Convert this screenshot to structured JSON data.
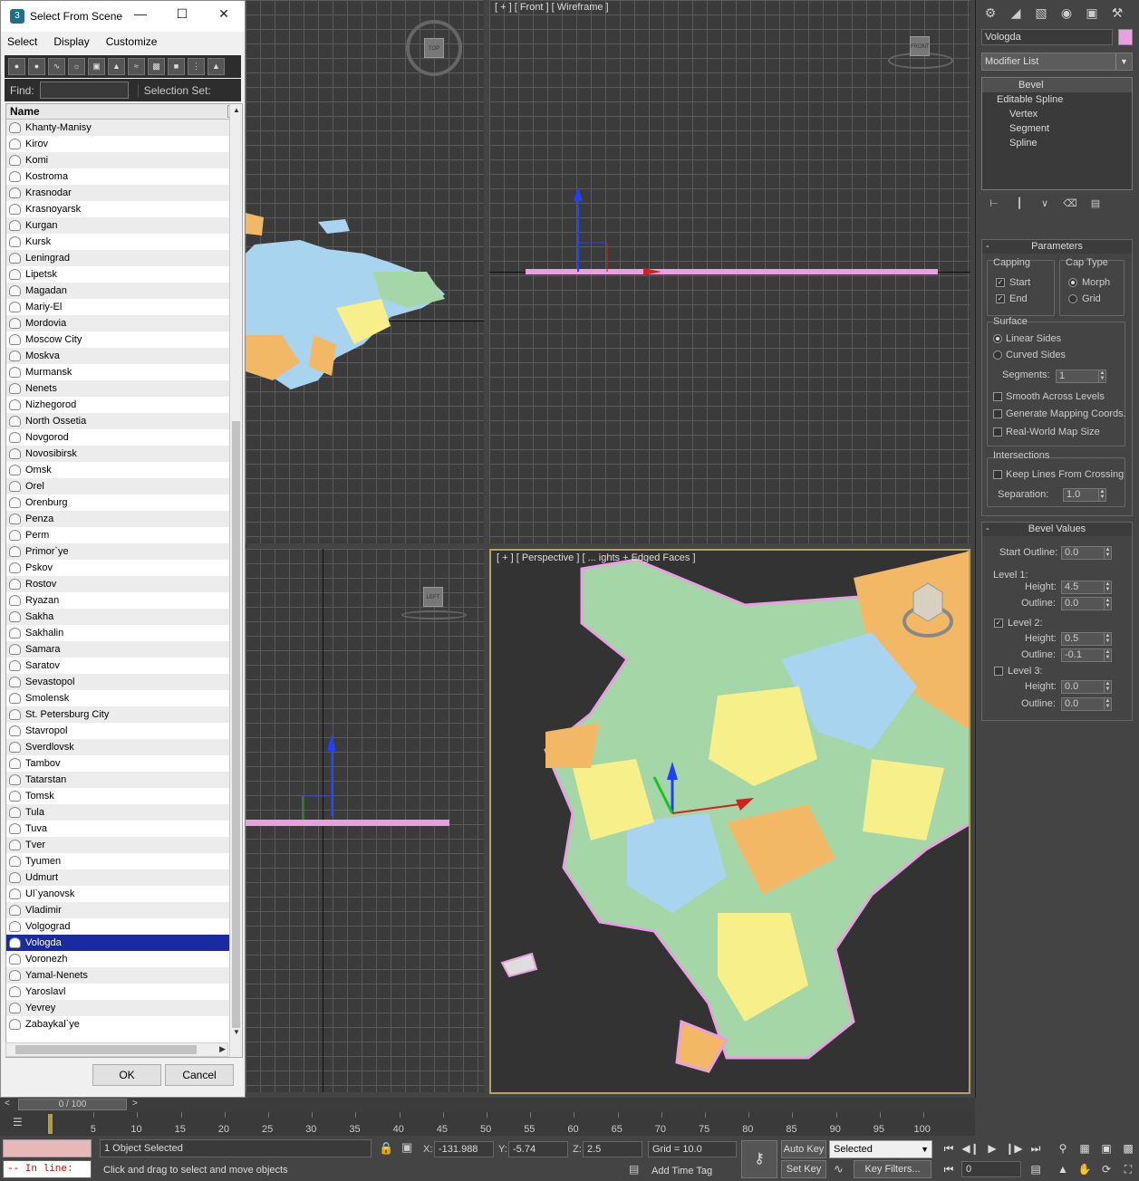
{
  "dialog": {
    "title": "Select From Scene",
    "menu": [
      "Select",
      "Display",
      "Customize"
    ],
    "find_label": "Find:",
    "find_value": "",
    "selection_set_label": "Selection Set:",
    "column_header": "Name",
    "items": [
      "Khanty-Manisy",
      "Kirov",
      "Komi",
      "Kostroma",
      "Krasnodar",
      "Krasnoyarsk",
      "Kurgan",
      "Kursk",
      "Leningrad",
      "Lipetsk",
      "Magadan",
      "Mariy-El",
      "Mordovia",
      "Moscow City",
      "Moskva",
      "Murmansk",
      "Nenets",
      "Nizhegorod",
      "North Ossetia",
      "Novgorod",
      "Novosibirsk",
      "Omsk",
      "Orel",
      "Orenburg",
      "Penza",
      "Perm",
      "Primor`ye",
      "Pskov",
      "Rostov",
      "Ryazan",
      "Sakha",
      "Sakhalin",
      "Samara",
      "Saratov",
      "Sevastopol",
      "Smolensk",
      "St. Petersburg City",
      "Stavropol",
      "Sverdlovsk",
      "Tambov",
      "Tatarstan",
      "Tomsk",
      "Tula",
      "Tuva",
      "Tver",
      "Tyumen",
      "Udmurt",
      "Ul`yanovsk",
      "Vladimir",
      "Volgograd",
      "Vologda",
      "Voronezh",
      "Yamal-Nenets",
      "Yaroslavl",
      "Yevrey",
      "Zabaykal`ye"
    ],
    "selected": "Vologda",
    "ok": "OK",
    "cancel": "Cancel"
  },
  "viewports": {
    "front_label": "[ + ] [ Front ] [ Wireframe ]",
    "perspective_label": "[ + ] [ Perspective ] [ ... ights + Edged Faces ]"
  },
  "command_panel": {
    "object_name": "Vologda",
    "object_color": "#e8a0e0",
    "modifier_list": "Modifier List",
    "stack": [
      "Bevel",
      "Editable Spline",
      "Vertex",
      "Segment",
      "Spline"
    ],
    "parameters": {
      "title": "Parameters",
      "capping": "Capping",
      "start": "Start",
      "end": "End",
      "cap_type": "Cap Type",
      "morph": "Morph",
      "grid": "Grid",
      "surface": "Surface",
      "linear_sides": "Linear Sides",
      "curved_sides": "Curved Sides",
      "segments_label": "Segments:",
      "segments": "1",
      "smooth": "Smooth Across Levels",
      "gen_mapping": "Generate Mapping Coords.",
      "real_world": "Real-World Map Size",
      "intersections": "Intersections",
      "keep_lines": "Keep Lines From Crossing",
      "separation_label": "Separation:",
      "separation": "1.0"
    },
    "bevel": {
      "title": "Bevel Values",
      "start_outline_label": "Start Outline:",
      "start_outline": "0.0",
      "level1": "Level 1:",
      "height_label": "Height:",
      "outline_label": "Outline:",
      "l1_height": "4.5",
      "l1_outline": "0.0",
      "level2": "Level 2:",
      "l2_height": "0.5",
      "l2_outline": "-0.1",
      "level3": "Level 3:",
      "l3_height": "0.0",
      "l3_outline": "0.0"
    }
  },
  "timeline": {
    "frame": "0 / 100",
    "ticks": [
      "5",
      "10",
      "15",
      "20",
      "25",
      "30",
      "35",
      "40",
      "45",
      "50",
      "55",
      "60",
      "65",
      "70",
      "75",
      "80",
      "85",
      "90",
      "95",
      "100"
    ]
  },
  "status": {
    "in_line": "-- In line:",
    "selected_text": "1 Object Selected",
    "prompt": "Click and drag to select and move objects",
    "x_label": "X:",
    "x": "-131.988",
    "y_label": "Y:",
    "y": "-5.74",
    "z_label": "Z:",
    "z": "2.5",
    "grid": "Grid = 10.0",
    "add_time_tag": "Add Time Tag",
    "auto_key": "Auto Key",
    "set_key": "Set Key",
    "selected_dd": "Selected",
    "key_filters": "Key Filters...",
    "frame_field": "0"
  }
}
